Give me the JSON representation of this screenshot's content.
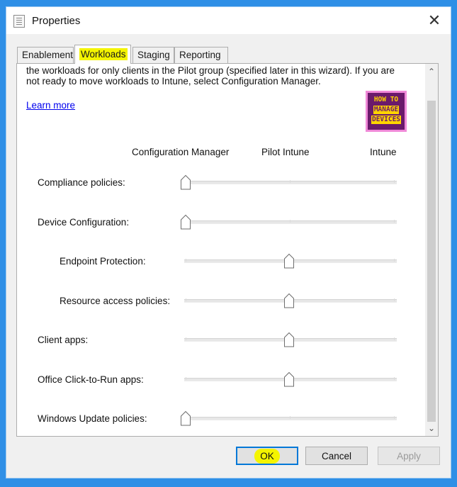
{
  "window": {
    "title": "Properties",
    "close_glyph": "✕"
  },
  "tabs": [
    {
      "label": "Enablement"
    },
    {
      "label": "Workloads",
      "active": true,
      "highlight": "#f4f400"
    },
    {
      "label": "Staging"
    },
    {
      "label": "Reporting"
    }
  ],
  "panel": {
    "intro_text": "the workloads for only clients in the Pilot group (specified later in this wizard). If you are not ready to move workloads to Intune, select Configuration Manager.",
    "learn_more": "Learn more",
    "logo": {
      "line1": "HOW TO",
      "line2": "MANAGE",
      "line3": "DEVICES"
    },
    "columns": [
      "Configuration Manager",
      "Pilot Intune",
      "Intune"
    ],
    "workloads": [
      {
        "label": "Compliance policies:",
        "position": "Configuration Manager",
        "indent": false
      },
      {
        "label": "Device Configuration:",
        "position": "Configuration Manager",
        "indent": false
      },
      {
        "label": "Endpoint Protection:",
        "position": "Pilot Intune",
        "indent": true
      },
      {
        "label": "Resource access policies:",
        "position": "Pilot Intune",
        "indent": true
      },
      {
        "label": "Client apps:",
        "position": "Pilot Intune",
        "indent": false
      },
      {
        "label": "Office Click-to-Run apps:",
        "position": "Pilot Intune",
        "indent": false
      },
      {
        "label": "Windows Update policies:",
        "position": "Configuration Manager",
        "indent": false
      }
    ]
  },
  "scrollbar": {
    "up_glyph": "⌃",
    "down_glyph": "⌄"
  },
  "buttons": {
    "ok": "OK",
    "cancel": "Cancel",
    "apply": "Apply"
  },
  "colors": {
    "accent": "#0078d7",
    "highlight": "#f4f400",
    "link": "#0000ee",
    "background": "#2f8fe6"
  }
}
